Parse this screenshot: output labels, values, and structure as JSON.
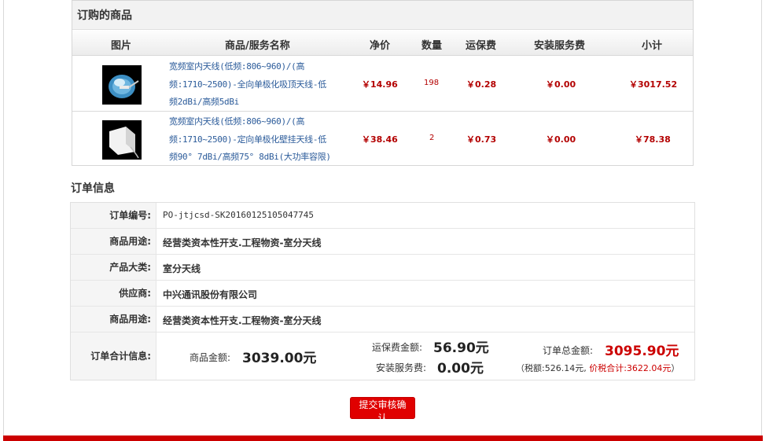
{
  "products_section": {
    "title": "订购的商品",
    "columns": {
      "image": "图片",
      "name": "商品/服务名称",
      "unit_price": "净价",
      "quantity": "数量",
      "shipping": "运保费",
      "install": "安装服务费",
      "subtotal": "小计"
    },
    "items": [
      {
        "name_lines": [
          "宽频室内天线(低频:806~960)/(高",
          "频:1710~2500)-全向单极化吸顶天线-低",
          "频2dBi/高频5dBi"
        ],
        "unit_price": "￥14.96",
        "quantity": "198",
        "shipping": "￥0.28",
        "install": "￥0.00",
        "subtotal": "￥3017.52"
      },
      {
        "name_lines": [
          "宽频室内天线(低频:806~960)/(高",
          "频:1710~2500)-定向单极化壁挂天线-低",
          "频90° 7dBi/高频75° 8dBi(大功率容限)"
        ],
        "unit_price": "￥38.46",
        "quantity": "2",
        "shipping": "￥0.73",
        "install": "￥0.00",
        "subtotal": "￥78.38"
      }
    ]
  },
  "order_info": {
    "title": "订单信息",
    "rows": [
      {
        "label": "订单编号:",
        "value": "PO-jtjcsd-SK20160125105047745"
      },
      {
        "label": "商品用途:",
        "value": "经营类资本性开支.工程物资-室分天线"
      },
      {
        "label": "产品大类:",
        "value": "室分天线"
      },
      {
        "label": "供应商:",
        "value": "中兴通讯股份有限公司"
      },
      {
        "label": "商品用途:",
        "value": "经营类资本性开支.工程物资-室分天线"
      }
    ],
    "totals": {
      "label": "订单合计信息:",
      "goods_label": "商品金额:",
      "goods_value": "3039.00元",
      "shipping_label": "运保费金额:",
      "shipping_value": "56.90元",
      "install_label": "安装服务费:",
      "install_value": "0.00元",
      "order_total_label": "订单总金额:",
      "order_total_value": "3095.90元",
      "tax_prefix": "（税额:526.14元,",
      "tax_total": "价税合计:3622.04元",
      "tax_suffix": "）"
    }
  },
  "actions": {
    "submit_label": "提交审核确认"
  },
  "colors": {
    "accent_red": "#cc0000",
    "link_blue": "#2b5b9a",
    "header_gray": "#f2f2f2"
  }
}
